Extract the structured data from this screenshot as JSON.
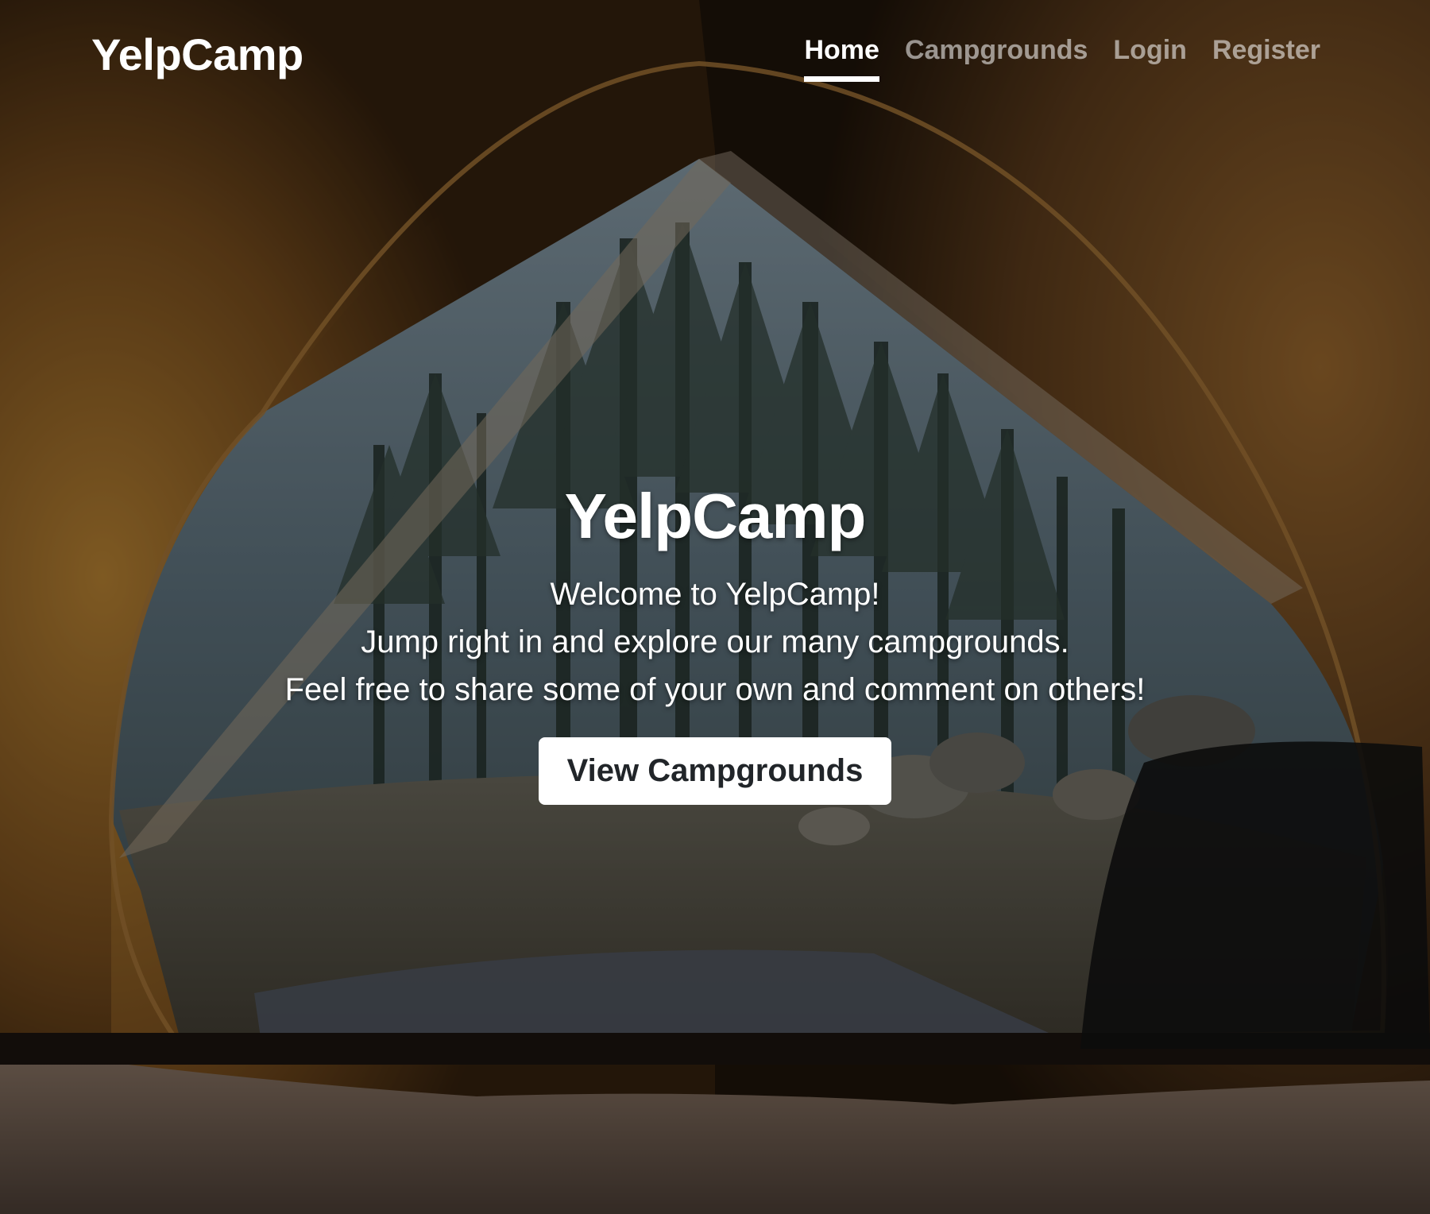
{
  "navbar": {
    "brand": "YelpCamp",
    "links": [
      {
        "label": "Home",
        "active": true
      },
      {
        "label": "Campgrounds",
        "active": false
      },
      {
        "label": "Login",
        "active": false
      },
      {
        "label": "Register",
        "active": false
      }
    ]
  },
  "hero": {
    "title": "YelpCamp",
    "lines": [
      "Welcome to YelpCamp!",
      "Jump right in and explore our many campgrounds.",
      "Feel free to share some of your own and comment on others!"
    ],
    "cta_label": "View Campgrounds"
  },
  "colors": {
    "text": "#ffffff",
    "muted_nav": "rgba(255,255,255,0.55)",
    "button_bg": "#ffffff",
    "button_text": "#212529",
    "tent_canvas": "#8a5a22",
    "forest": "#3f5560"
  }
}
